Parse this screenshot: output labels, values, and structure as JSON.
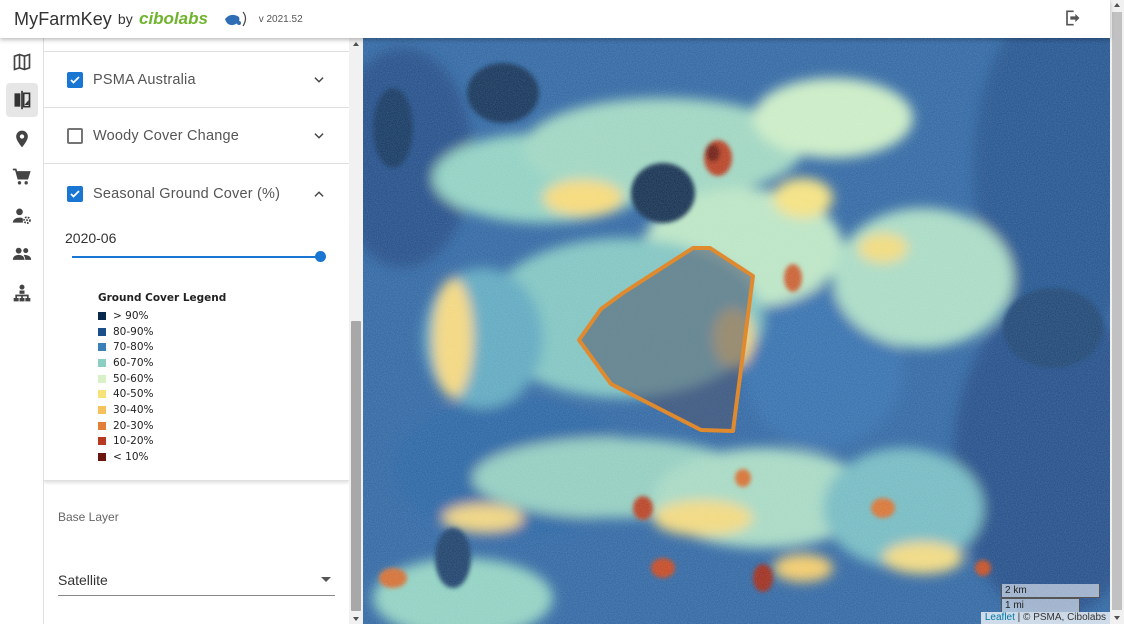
{
  "header": {
    "app_name": "MyFarmKey",
    "by": "by",
    "logo_text": "cibolabs",
    "version": "v 2021.52",
    "logout_icon": "logout-icon"
  },
  "nav": {
    "items": [
      {
        "name": "map",
        "icon": "map-icon",
        "active": false
      },
      {
        "name": "layers",
        "icon": "layers-compare-icon",
        "active": true
      },
      {
        "name": "location",
        "icon": "location-pin-icon",
        "active": false
      },
      {
        "name": "shop",
        "icon": "cart-icon",
        "active": false
      },
      {
        "name": "account",
        "icon": "person-settings-icon",
        "active": false
      },
      {
        "name": "users",
        "icon": "people-icon",
        "active": false
      },
      {
        "name": "hierarchy",
        "icon": "org-chart-icon",
        "active": false
      }
    ]
  },
  "layers": [
    {
      "label": "PSMA Australia",
      "checked": true,
      "expanded": false
    },
    {
      "label": "Woody Cover Change",
      "checked": false,
      "expanded": false
    },
    {
      "label": "Seasonal Ground Cover (%)",
      "checked": true,
      "expanded": true
    }
  ],
  "ground_cover": {
    "date": "2020-06",
    "slider_fraction": 1.0,
    "legend_title": "Ground Cover Legend",
    "legend": [
      {
        "label": "> 90%",
        "color": "#0a2a4c"
      },
      {
        "label": "80-90%",
        "color": "#1a4f8a"
      },
      {
        "label": "70-80%",
        "color": "#3a7fb5"
      },
      {
        "label": "60-70%",
        "color": "#8ccfc0"
      },
      {
        "label": "50-60%",
        "color": "#d9f1c6"
      },
      {
        "label": "40-50%",
        "color": "#f7e27a"
      },
      {
        "label": "30-40%",
        "color": "#f5c15a"
      },
      {
        "label": "20-30%",
        "color": "#e2803a"
      },
      {
        "label": "10-20%",
        "color": "#b53a1f"
      },
      {
        "label": "< 10%",
        "color": "#6a1510"
      }
    ]
  },
  "base_layer": {
    "title": "Base Layer",
    "value": "Satellite"
  },
  "map": {
    "scale_km": "2 km",
    "scale_mi": "1 mi",
    "attribution_link": "Leaflet",
    "attribution_rest": " | © PSMA, Cibolabs",
    "paddock_color": "#e08a30"
  }
}
